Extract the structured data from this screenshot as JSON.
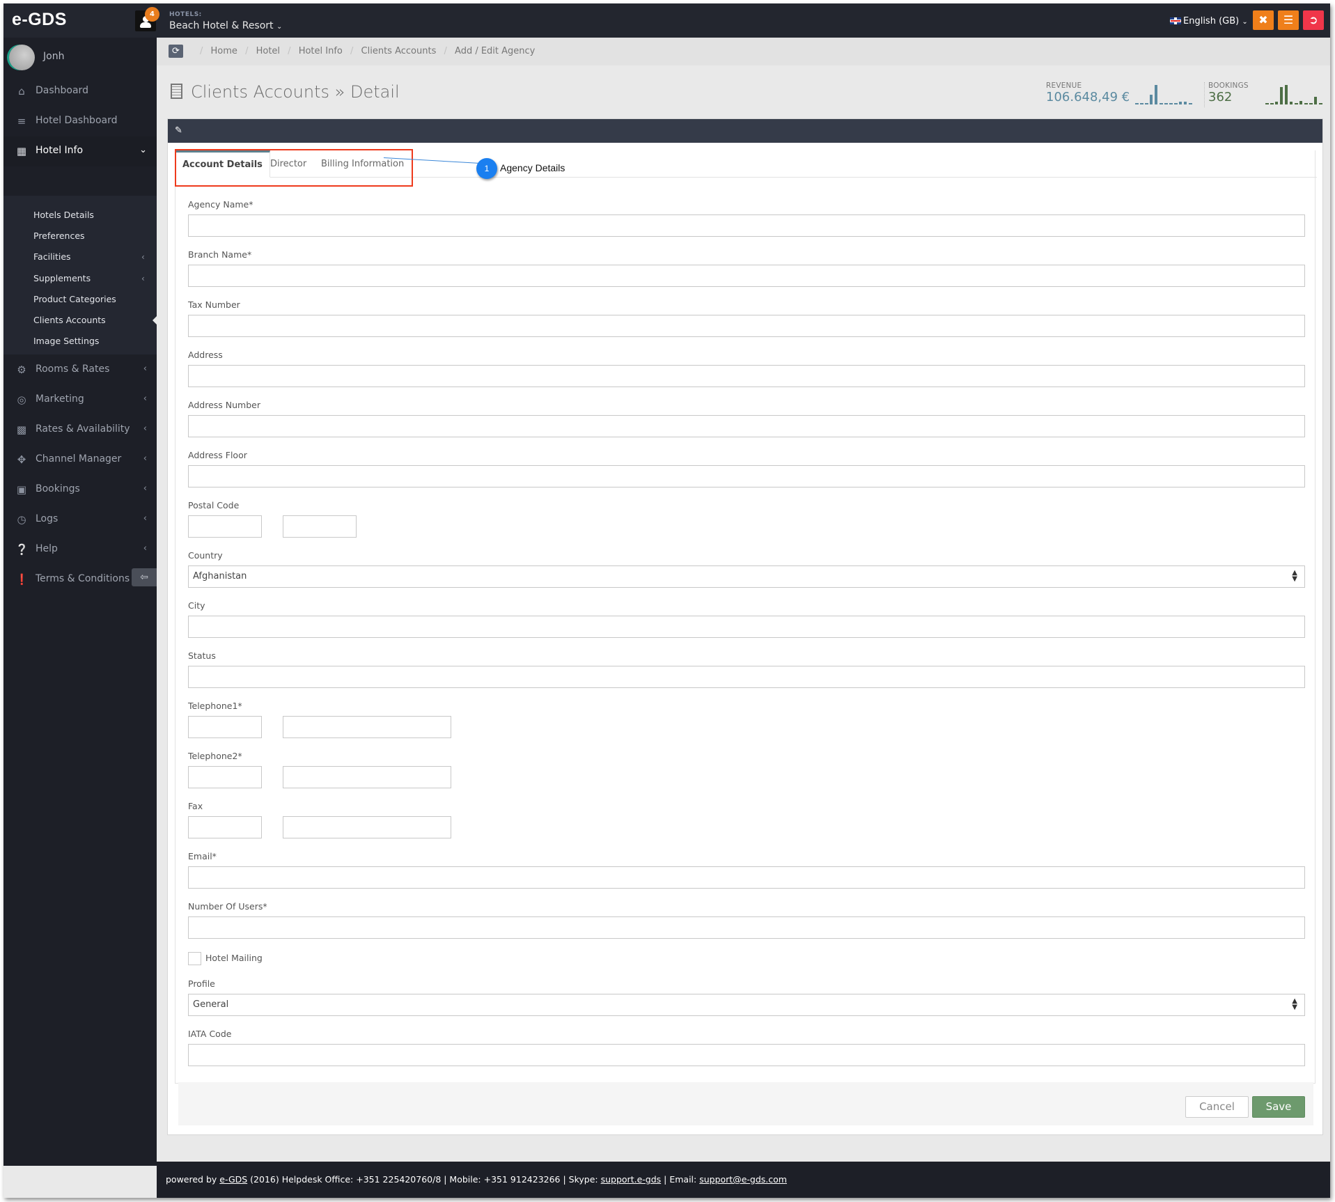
{
  "app": {
    "logo": "e-GDS",
    "notification_count": "4",
    "hotels_label": "HOTELS:",
    "hotel_selected": "Beach Hotel & Resort",
    "language": "English (GB)"
  },
  "toolbar": {
    "fullscreen_icon": "expand-icon",
    "menu_icon": "bars-icon",
    "logout_icon": "sign-out-icon",
    "colors": {
      "fullscreen": "#ef7f1a",
      "menu": "#ef7f1a",
      "logout": "#f0364a"
    }
  },
  "sidebar": {
    "user_name": "Jonh",
    "items": [
      {
        "label": "Dashboard",
        "icon": "home-icon"
      },
      {
        "label": "Hotel Dashboard",
        "icon": "tasks-icon"
      },
      {
        "label": "Hotel Info",
        "icon": "building-icon",
        "expanded": true
      },
      {
        "label": "Rooms & Rates",
        "icon": "cogs-icon"
      },
      {
        "label": "Marketing",
        "icon": "bullseye-icon"
      },
      {
        "label": "Rates & Availability",
        "icon": "bar-chart-icon"
      },
      {
        "label": "Channel Manager",
        "icon": "arrows-icon"
      },
      {
        "label": "Bookings",
        "icon": "shopping-cart-icon"
      },
      {
        "label": "Logs",
        "icon": "clock-icon"
      },
      {
        "label": "Help",
        "icon": "question-circle-icon"
      },
      {
        "label": "Terms & Conditions",
        "icon": "exclamation-circle-icon"
      }
    ],
    "hotel_info_subitems": [
      {
        "label": "Hotels Details"
      },
      {
        "label": "Preferences"
      },
      {
        "label": "Facilities",
        "has_children": true
      },
      {
        "label": "Supplements",
        "has_children": true
      },
      {
        "label": "Product Categories"
      },
      {
        "label": "Clients Accounts",
        "active": true
      },
      {
        "label": "Image Settings"
      }
    ]
  },
  "breadcrumb": [
    "Home",
    "Hotel",
    "Hotel Info",
    "Clients Accounts",
    "Add / Edit Agency"
  ],
  "page": {
    "title": "Clients Accounts » Detail",
    "revenue_label": "REVENUE",
    "revenue_value": "106.648,49 €",
    "revenue_color": "#5b8aa0",
    "revenue_sparkline": [
      1,
      1,
      1,
      8,
      16,
      1,
      1,
      1,
      1,
      2,
      2,
      1
    ],
    "bookings_label": "BOOKINGS",
    "bookings_value": "362",
    "bookings_color": "#4d6e45",
    "bookings_sparkline": [
      1,
      1,
      2,
      14,
      16,
      2,
      1,
      3,
      1,
      1,
      6,
      1
    ]
  },
  "tabs": [
    {
      "label": "Account Details",
      "active": true
    },
    {
      "label": "Director"
    },
    {
      "label": "Billing Information"
    }
  ],
  "annotation": {
    "number": "1",
    "label": "Agency Details"
  },
  "form": {
    "agency_name": {
      "label": "Agency Name*",
      "value": ""
    },
    "branch_name": {
      "label": "Branch Name*",
      "value": ""
    },
    "tax_number": {
      "label": "Tax Number",
      "value": ""
    },
    "address": {
      "label": "Address",
      "value": ""
    },
    "address_number": {
      "label": "Address Number",
      "value": ""
    },
    "address_floor": {
      "label": "Address Floor",
      "value": ""
    },
    "postal_code": {
      "label": "Postal Code",
      "value1": "",
      "value2": ""
    },
    "country": {
      "label": "Country",
      "value": "Afghanistan"
    },
    "city": {
      "label": "City",
      "value": ""
    },
    "status": {
      "label": "Status",
      "value": ""
    },
    "telephone1": {
      "label": "Telephone1*",
      "code": "",
      "number": ""
    },
    "telephone2": {
      "label": "Telephone2*",
      "code": "",
      "number": ""
    },
    "fax": {
      "label": "Fax",
      "code": "",
      "number": ""
    },
    "email": {
      "label": "Email*",
      "value": ""
    },
    "number_of_users": {
      "label": "Number Of Users*",
      "value": ""
    },
    "hotel_mailing": {
      "label": "Hotel Mailing",
      "checked": false
    },
    "profile": {
      "label": "Profile",
      "value": "General"
    },
    "iata_code": {
      "label": "IATA Code",
      "value": ""
    }
  },
  "actions": {
    "cancel": "Cancel",
    "save": "Save"
  },
  "footer": {
    "prefix": "powered by",
    "brand_link": "e-GDS",
    "text": "(2016) Helpdesk Office: +351 225420760/8 | Mobile: +351 912423266 | Skype:",
    "skype_link": "support.e-gds",
    "email_prefix": "| Email:",
    "email_link": "support@e-gds.com"
  }
}
